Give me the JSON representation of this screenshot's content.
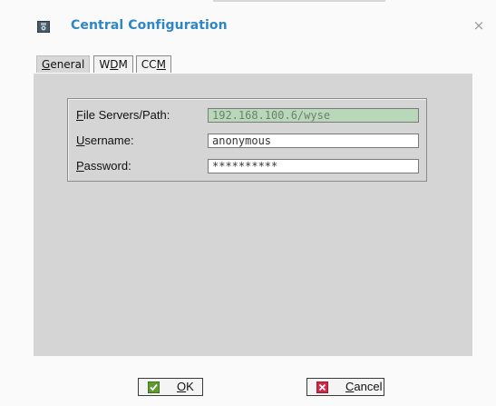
{
  "window": {
    "title": "Central Configuration",
    "close_glyph": "×",
    "title_icon": "gear-icon"
  },
  "tabs": [
    {
      "id": "general",
      "pre": "",
      "mn": "G",
      "post": "eneral",
      "active": true
    },
    {
      "id": "wdm",
      "pre": "W",
      "mn": "D",
      "post": "M",
      "active": false
    },
    {
      "id": "ccm",
      "pre": "CC",
      "mn": "M",
      "post": "",
      "active": false
    }
  ],
  "form": {
    "file_servers": {
      "pre": "",
      "mn": "F",
      "post": "ile Servers/Path:",
      "value": "192.168.100.6/wyse",
      "disabled": true
    },
    "username": {
      "pre": "",
      "mn": "U",
      "post": "sername:",
      "value": "anonymous"
    },
    "password": {
      "pre": "",
      "mn": "P",
      "post": "assword:",
      "value": "**********"
    }
  },
  "buttons": {
    "ok": {
      "pre": "",
      "mn": "O",
      "post": "K",
      "icon": "check-icon",
      "icon_color": "#5e9b2f"
    },
    "cancel": {
      "pre": "",
      "mn": "C",
      "post": "ancel",
      "icon": "cancel-icon",
      "icon_color": "#d1284a"
    }
  }
}
